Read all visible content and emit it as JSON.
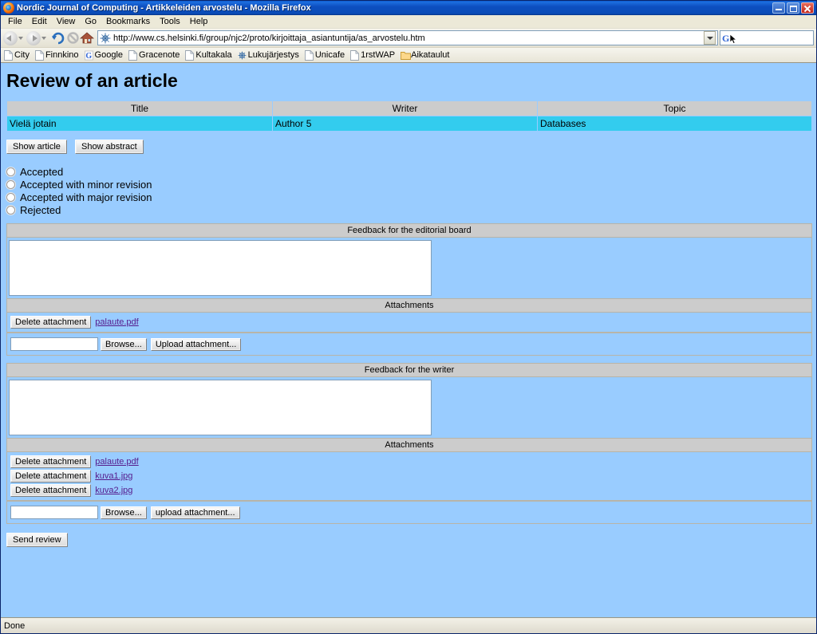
{
  "window": {
    "title": "Nordic Journal of Computing - Artikkeleiden arvostelu - Mozilla Firefox",
    "minimize_label": "Minimize",
    "restore_label": "Restore",
    "close_label": "Close"
  },
  "menu": {
    "items": [
      "File",
      "Edit",
      "View",
      "Go",
      "Bookmarks",
      "Tools",
      "Help"
    ]
  },
  "toolbar": {
    "back_label": "Back",
    "forward_label": "Forward",
    "reload_label": "Reload",
    "stop_label": "Stop",
    "home_label": "Home",
    "url": "http://www.cs.helsinki.fi/group/njc2/proto/kirjoittaja_asiantuntija/as_arvostelu.htm",
    "search_value": "",
    "search_engine": "G"
  },
  "bookmarks": [
    {
      "label": "City",
      "icon": "page-icon"
    },
    {
      "label": "Finnkino",
      "icon": "page-icon"
    },
    {
      "label": "Google",
      "icon": "google-icon"
    },
    {
      "label": "Gracenote",
      "icon": "page-icon"
    },
    {
      "label": "Kultakala",
      "icon": "page-icon"
    },
    {
      "label": "Lukujärjestys",
      "icon": "globe-icon"
    },
    {
      "label": "Unicafe",
      "icon": "page-icon"
    },
    {
      "label": "1rstWAP",
      "icon": "page-icon"
    },
    {
      "label": "Aikataulut",
      "icon": "folder-icon"
    }
  ],
  "page": {
    "title": "Review of an article",
    "table": {
      "headers": [
        "Title",
        "Writer",
        "Topic"
      ],
      "rows": [
        {
          "title": "Vielä jotain",
          "writer": "Author 5",
          "topic": "Databases"
        }
      ]
    },
    "article_buttons": {
      "show_article": "Show article",
      "show_abstract": "Show abstract"
    },
    "decision_options": [
      {
        "label": "Accepted",
        "selected": false
      },
      {
        "label": "Accepted with minor revision",
        "selected": false
      },
      {
        "label": "Accepted with major revision",
        "selected": false
      },
      {
        "label": "Rejected",
        "selected": false
      }
    ],
    "editorial_feedback": {
      "header": "Feedback for the editorial board",
      "textarea_value": "",
      "attachments_header": "Attachments",
      "attachments": [
        {
          "delete_label": "Delete attachment",
          "filename": "palaute.pdf"
        }
      ],
      "file_value": "",
      "browse_label": "Browse...",
      "upload_label": "Upload attachment..."
    },
    "writer_feedback": {
      "header": "Feedback for the writer",
      "textarea_value": "",
      "attachments_header": "Attachments",
      "attachments": [
        {
          "delete_label": "Delete attachment",
          "filename": "palaute.pdf"
        },
        {
          "delete_label": "Delete attachment",
          "filename": "kuva1.jpg"
        },
        {
          "delete_label": "Delete attachment",
          "filename": "kuva2.jpg"
        }
      ],
      "file_value": "",
      "browse_label": "Browse...",
      "upload_label": "upload attachment..."
    },
    "send_label": "Send review"
  },
  "statusbar": {
    "text": "Done"
  },
  "colors": {
    "page_background": "#99ccff",
    "table_header": "#cccccc",
    "table_row": "#33ccee",
    "link": "#551a8b",
    "titlebar": "#0a4cb8"
  }
}
